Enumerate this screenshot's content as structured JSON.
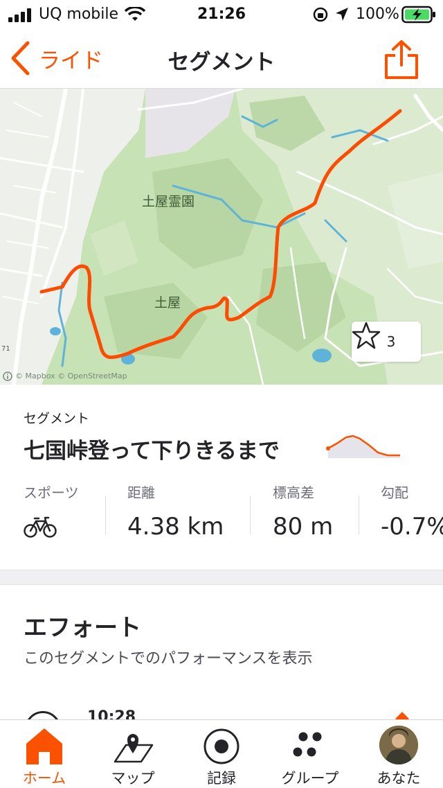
{
  "status_bar": {
    "carrier": "UQ mobile",
    "time": "21:26",
    "battery": "100%"
  },
  "nav": {
    "back_label": "ライド",
    "title": "セグメント"
  },
  "map": {
    "place_1": "土屋霊園",
    "place_2": "土屋",
    "road_number": "71",
    "attribution": "© Mapbox © OpenStreetMap",
    "star_count": "3"
  },
  "segment": {
    "kicker": "セグメント",
    "name": "七国峠登って下りきるまで",
    "stats": [
      {
        "label": "スポーツ",
        "icon": "bicycle-icon"
      },
      {
        "label": "距離",
        "value": "4.38 km"
      },
      {
        "label": "標高差",
        "value": "80 m"
      },
      {
        "label": "勾配",
        "value": "-0.7%"
      }
    ]
  },
  "effort": {
    "heading": "エフォート",
    "subtitle": "このセグメントでのパフォーマンスを表示",
    "peek_time": "10:28"
  },
  "tabs": [
    {
      "label": "ホーム",
      "icon": "home-icon",
      "active": true
    },
    {
      "label": "マップ",
      "icon": "map-icon",
      "active": false
    },
    {
      "label": "記録",
      "icon": "record-icon",
      "active": false
    },
    {
      "label": "グループ",
      "icon": "groups-icon",
      "active": false
    },
    {
      "label": "あなた",
      "icon": "avatar",
      "active": false
    }
  ],
  "colors": {
    "accent": "#fc5200",
    "map_green": "#c7e2b5",
    "water": "#5fb3d9"
  }
}
